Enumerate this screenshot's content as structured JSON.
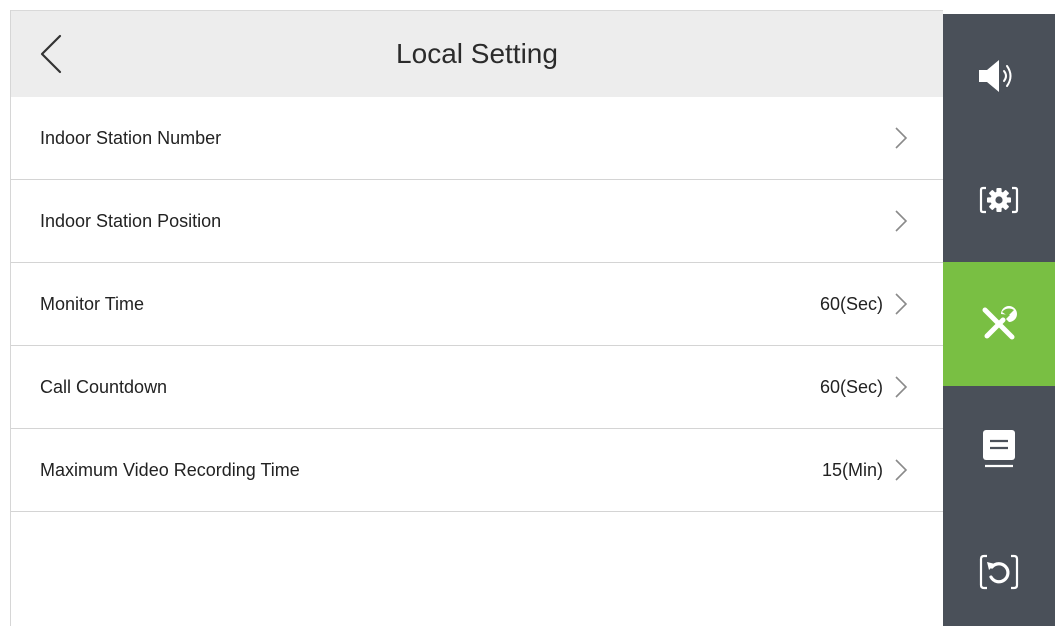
{
  "header": {
    "title": "Local Setting"
  },
  "settings": [
    {
      "label": "Indoor Station Number",
      "value": ""
    },
    {
      "label": "Indoor Station Position",
      "value": ""
    },
    {
      "label": "Monitor Time",
      "value": "60(Sec)"
    },
    {
      "label": "Call Countdown",
      "value": "60(Sec)"
    },
    {
      "label": "Maximum Video Recording Time",
      "value": "15(Min)"
    }
  ],
  "sidebar": {
    "items": [
      {
        "icon": "speaker-icon",
        "active": false
      },
      {
        "icon": "gear-icon",
        "active": false
      },
      {
        "icon": "tools-icon",
        "active": true
      },
      {
        "icon": "message-icon",
        "active": false
      },
      {
        "icon": "restore-icon",
        "active": false
      }
    ]
  },
  "colors": {
    "header_bg": "#ededed",
    "sidebar_bg": "#4a5059",
    "active_accent": "#79bf43"
  }
}
